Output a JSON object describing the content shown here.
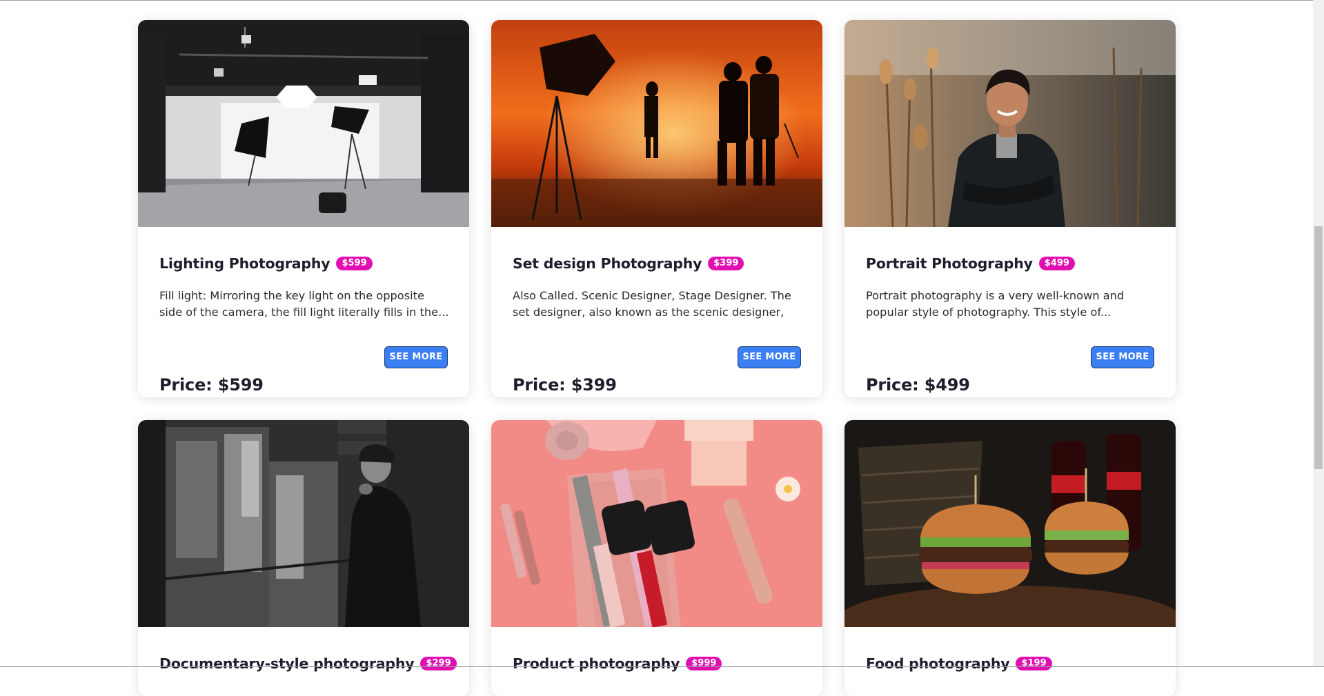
{
  "cards": [
    {
      "title": "Lighting Photography",
      "badge": "$599",
      "description": "Fill light: Mirroring the key light on the opposite side of the camera, the fill light literally fills in the...",
      "button": "SEE MORE",
      "price": "Price: $599",
      "image": "studio-lighting-photo"
    },
    {
      "title": "Set design Photography",
      "badge": "$399",
      "description": "Also Called. Scenic Designer, Stage Designer. The set designer, also known as the scenic designer, is...",
      "button": "SEE MORE",
      "price": "Price: $399",
      "image": "fire-backdrop-set-photo"
    },
    {
      "title": "Portrait Photography",
      "badge": "$499",
      "description": "Portrait photography is a very well-known and popular style of photography. This style of...",
      "button": "SEE MORE",
      "price": "Price: $499",
      "image": "smiling-man-portrait-photo"
    },
    {
      "title": "Documentary-style photography",
      "badge": "$299",
      "image": "black-white-documentary-photo"
    },
    {
      "title": "Product photography",
      "badge": "$999",
      "image": "pink-smartwatch-product-photo"
    },
    {
      "title": "Food photography",
      "badge": "$199",
      "image": "burgers-food-photo"
    }
  ],
  "colors": {
    "badge": "#e10fb2",
    "button": "#3b7ff2"
  }
}
